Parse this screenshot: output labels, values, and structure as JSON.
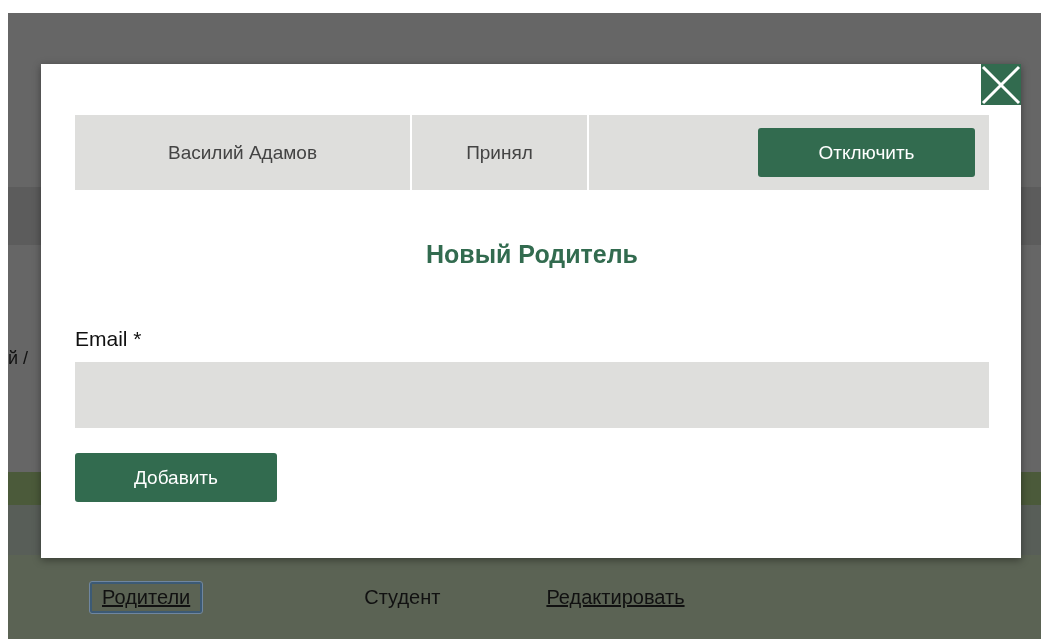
{
  "background_page": {
    "breadcrumb_fragment": "й /",
    "links": [
      {
        "kind": "link",
        "label": "Родители",
        "focused": true
      },
      {
        "kind": "text",
        "label": "Студент",
        "focused": false
      },
      {
        "kind": "link",
        "label": "Редактировать",
        "focused": false
      }
    ]
  },
  "modal": {
    "parent_row": {
      "name": "Василий Адамов",
      "status": "Принял",
      "action": "Отключить"
    },
    "heading": "Новый Родитель",
    "email_field": {
      "label": "Email *"
    },
    "submit": "Добавить"
  }
}
